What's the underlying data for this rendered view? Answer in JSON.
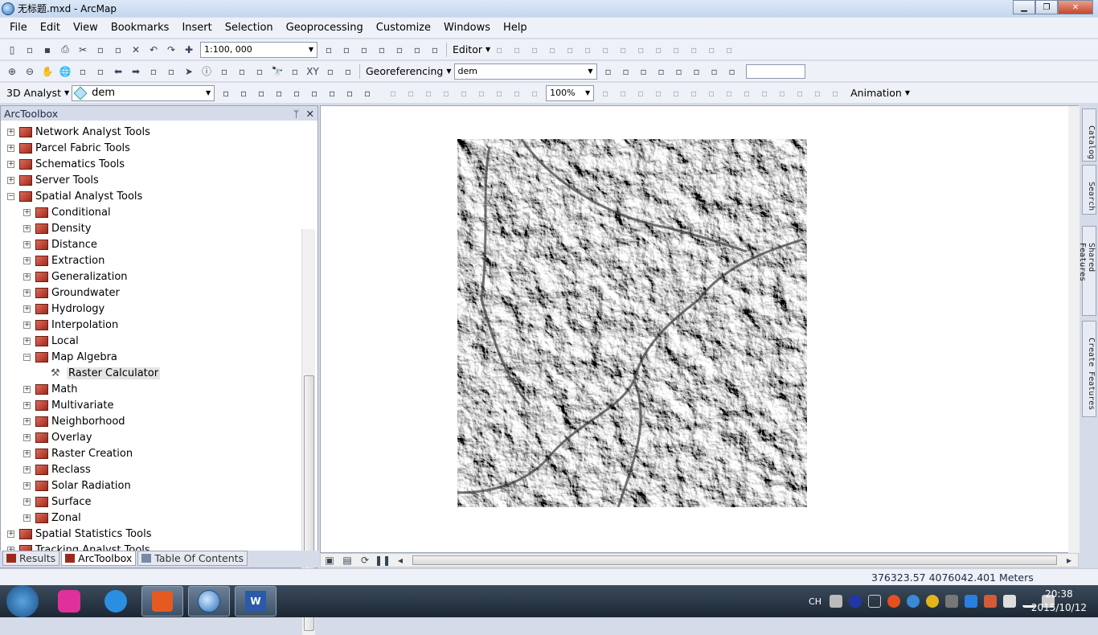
{
  "window": {
    "title": "无标题.mxd - ArcMap",
    "minimize": "▁",
    "maximize": "❐",
    "close": "✕"
  },
  "menu": [
    "File",
    "Edit",
    "View",
    "Bookmarks",
    "Insert",
    "Selection",
    "Geoprocessing",
    "Customize",
    "Windows",
    "Help"
  ],
  "toolbar1": {
    "icons_a": [
      "new-icon",
      "open-icon",
      "save-icon",
      "print-icon",
      "cut-icon",
      "copy-icon",
      "paste-icon",
      "delete-icon",
      "undo-icon",
      "redo-icon",
      "add-data-icon"
    ],
    "scale": "1:100, 000",
    "icons_b": [
      "editor-toolbar-icon",
      "toc-icon",
      "catalog-icon",
      "search-window-icon",
      "arctoolbox-icon",
      "python-icon",
      "modelbuilder-icon"
    ],
    "editor_label": "Editor",
    "icons_c": [
      "edit-tool-icon",
      "edit-annotation-icon",
      "straight-segment-icon",
      "endpoint-arc-icon",
      "trace-icon",
      "point-icon",
      "edit-vertices-icon",
      "reshape-icon",
      "cut-polygon-icon",
      "split-icon",
      "rotate-icon",
      "attributes-icon",
      "sketch-properties-icon",
      "editor-window-icon"
    ]
  },
  "toolbar2": {
    "icons_a": [
      "zoom-in-icon",
      "zoom-out-icon",
      "pan-icon",
      "full-extent-icon",
      "fixed-zoom-in-icon",
      "fixed-zoom-out-icon",
      "back-icon",
      "forward-icon",
      "select-features-icon",
      "clear-selection-icon",
      "select-elements-icon",
      "identify-icon",
      "hyperlink-icon",
      "html-popup-icon",
      "measure-icon",
      "find-icon",
      "find-route-icon",
      "goto-xy-icon",
      "time-slider-icon",
      "magnifier-icon"
    ],
    "georef_label": "Georeferencing",
    "georef_layer": "dem",
    "icons_b": [
      "add-control-points-icon",
      "auto-registration-icon",
      "select-link-icon",
      "zoom-to-link-icon",
      "delete-link-icon",
      "view-link-table-icon",
      "viewer-icon",
      "rotate-map-icon"
    ]
  },
  "toolbar3": {
    "analyst_label": "3D Analyst",
    "layer": "dem",
    "icons_a": [
      "contour-icon",
      "steepest-path-icon",
      "line-of-sight-icon",
      "point-profile-icon",
      "interpolate-line-icon",
      "interpolate-polygon-icon",
      "profile-graph-icon",
      "arcscene-icon",
      "arcglobe-icon"
    ],
    "zoom_pct": "100%",
    "animation_label": "Animation"
  },
  "toolbox": {
    "title": "ArcToolbox",
    "pin": "ᛘ",
    "close": "✕",
    "items": [
      {
        "label": "Network Analyst Tools",
        "level": 0,
        "exp": "+"
      },
      {
        "label": "Parcel Fabric Tools",
        "level": 0,
        "exp": "+"
      },
      {
        "label": "Schematics Tools",
        "level": 0,
        "exp": "+"
      },
      {
        "label": "Server Tools",
        "level": 0,
        "exp": "+"
      },
      {
        "label": "Spatial Analyst Tools",
        "level": 0,
        "exp": "−"
      },
      {
        "label": "Conditional",
        "level": 1,
        "exp": "+"
      },
      {
        "label": "Density",
        "level": 1,
        "exp": "+"
      },
      {
        "label": "Distance",
        "level": 1,
        "exp": "+"
      },
      {
        "label": "Extraction",
        "level": 1,
        "exp": "+"
      },
      {
        "label": "Generalization",
        "level": 1,
        "exp": "+"
      },
      {
        "label": "Groundwater",
        "level": 1,
        "exp": "+"
      },
      {
        "label": "Hydrology",
        "level": 1,
        "exp": "+"
      },
      {
        "label": "Interpolation",
        "level": 1,
        "exp": "+"
      },
      {
        "label": "Local",
        "level": 1,
        "exp": "+"
      },
      {
        "label": "Map Algebra",
        "level": 1,
        "exp": "−"
      },
      {
        "label": "Raster Calculator",
        "level": 2,
        "exp": ""
      },
      {
        "label": "Math",
        "level": 1,
        "exp": "+"
      },
      {
        "label": "Multivariate",
        "level": 1,
        "exp": "+"
      },
      {
        "label": "Neighborhood",
        "level": 1,
        "exp": "+"
      },
      {
        "label": "Overlay",
        "level": 1,
        "exp": "+"
      },
      {
        "label": "Raster Creation",
        "level": 1,
        "exp": "+"
      },
      {
        "label": "Reclass",
        "level": 1,
        "exp": "+"
      },
      {
        "label": "Solar Radiation",
        "level": 1,
        "exp": "+"
      },
      {
        "label": "Surface",
        "level": 1,
        "exp": "+"
      },
      {
        "label": "Zonal",
        "level": 1,
        "exp": "+"
      },
      {
        "label": "Spatial Statistics Tools",
        "level": 0,
        "exp": "+"
      },
      {
        "label": "Tracking Analyst Tools",
        "level": 0,
        "exp": "+"
      }
    ],
    "tabs": [
      "Results",
      "ArcToolbox",
      "Table Of Contents"
    ]
  },
  "right_tabs": [
    "Catalog",
    "Search",
    "Shared Features",
    "Create Features"
  ],
  "status": {
    "coords": "376323.57  4076042.401 Meters"
  },
  "taskbar": {
    "lang": "CH",
    "time": "20:38",
    "date": "2015/10/12"
  }
}
